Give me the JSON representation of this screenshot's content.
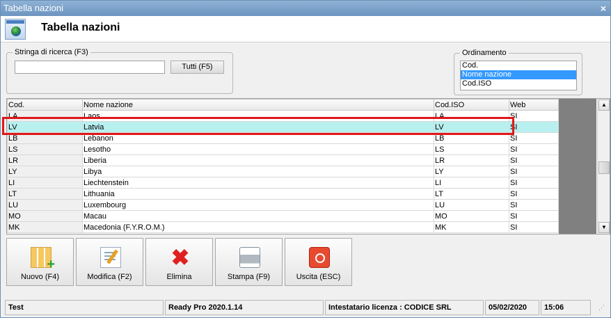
{
  "window": {
    "title": "Tabella nazioni",
    "close_glyph": "×"
  },
  "header": {
    "title": "Tabella nazioni",
    "icon": "globe-icon"
  },
  "search": {
    "label": "Stringa di ricerca (F3)",
    "value": "",
    "placeholder": "",
    "tutti_label": "Tutti (F5)"
  },
  "order": {
    "label": "Ordinamento",
    "options": [
      "Cod.",
      "Nome nazione",
      "Cod.ISO"
    ],
    "selected": "Nome nazione"
  },
  "grid": {
    "columns": [
      "Cod.",
      "Nome nazione",
      "Cod.ISO",
      "Web"
    ],
    "rows": [
      {
        "cod": "LA",
        "name": "Laos",
        "iso": "LA",
        "web": "SI"
      },
      {
        "cod": "LV",
        "name": "Latvia",
        "iso": "LV",
        "web": "SI"
      },
      {
        "cod": "LB",
        "name": "Lebanon",
        "iso": "LB",
        "web": "SI"
      },
      {
        "cod": "LS",
        "name": "Lesotho",
        "iso": "LS",
        "web": "SI"
      },
      {
        "cod": "LR",
        "name": "Liberia",
        "iso": "LR",
        "web": "SI"
      },
      {
        "cod": "LY",
        "name": "Libya",
        "iso": "LY",
        "web": "SI"
      },
      {
        "cod": "LI",
        "name": "Liechtenstein",
        "iso": "LI",
        "web": "SI"
      },
      {
        "cod": "LT",
        "name": "Lithuania",
        "iso": "LT",
        "web": "SI"
      },
      {
        "cod": "LU",
        "name": "Luxembourg",
        "iso": "LU",
        "web": "SI"
      },
      {
        "cod": "MO",
        "name": "Macau",
        "iso": "MO",
        "web": "SI"
      },
      {
        "cod": "MK",
        "name": "Macedonia (F.Y.R.O.M.)",
        "iso": "MK",
        "web": "SI"
      }
    ],
    "selected_row": 1,
    "scroll_up_glyph": "▲",
    "scroll_down_glyph": "▼"
  },
  "toolbar": {
    "buttons": [
      {
        "label": "Nuovo (F4)",
        "icon": "new-record-icon"
      },
      {
        "label": "Modifica (F2)",
        "icon": "edit-icon"
      },
      {
        "label": "Elimina",
        "icon": "delete-icon"
      },
      {
        "label": "Stampa (F9)",
        "icon": "printer-icon"
      },
      {
        "label": "Uscita (ESC)",
        "icon": "exit-icon"
      }
    ],
    "delete_glyph": "✖"
  },
  "status": {
    "user": "Test",
    "app": "Ready Pro 2020.1.14",
    "license": "Intestatario licenza : CODICE SRL",
    "date": "05/02/2020",
    "time": "15:06",
    "grip_glyph": "⋰"
  },
  "colors": {
    "selection_row": "#b8f0f0",
    "highlight_border": "#e01818",
    "list_selected": "#3399ff"
  }
}
